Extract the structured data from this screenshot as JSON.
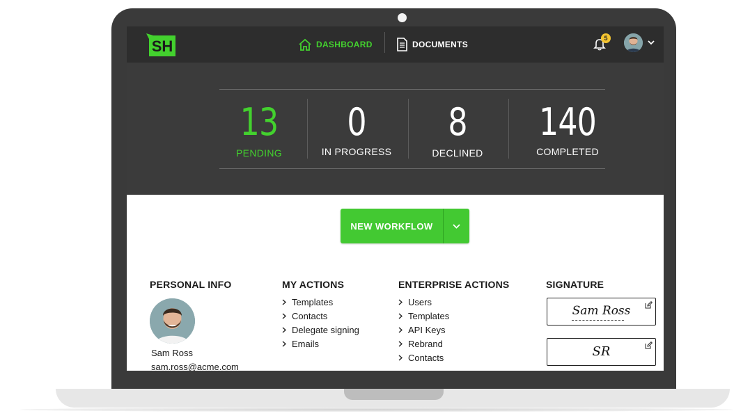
{
  "app": {
    "logo_text": "SH",
    "brand_color": "#43d12e"
  },
  "nav": {
    "dashboard_label": "DASHBOARD",
    "documents_label": "DOCUMENTS",
    "notification_count": "5"
  },
  "stats": [
    {
      "value": "13",
      "label": "PENDING",
      "active": true
    },
    {
      "value": "0",
      "label": "IN PROGRESS",
      "active": false
    },
    {
      "value": "8",
      "label": "DECLINED",
      "active": false
    },
    {
      "value": "140",
      "label": "COMPLETED",
      "active": false
    }
  ],
  "workflow_button": {
    "label": "NEW WORKFLOW"
  },
  "personal_info": {
    "title": "PERSONAL INFO",
    "name": "Sam Ross",
    "email": "sam.ross@acme.com"
  },
  "my_actions": {
    "title": "MY ACTIONS",
    "items": [
      "Templates",
      "Contacts",
      "Delegate signing",
      "Emails"
    ]
  },
  "enterprise_actions": {
    "title": "ENTERPRISE ACTIONS",
    "items": [
      "Users",
      "Templates",
      "API Keys",
      "Rebrand",
      "Contacts"
    ]
  },
  "signature": {
    "title": "SIGNATURE",
    "full_signature": "Sam Ross",
    "initials": "SR"
  }
}
